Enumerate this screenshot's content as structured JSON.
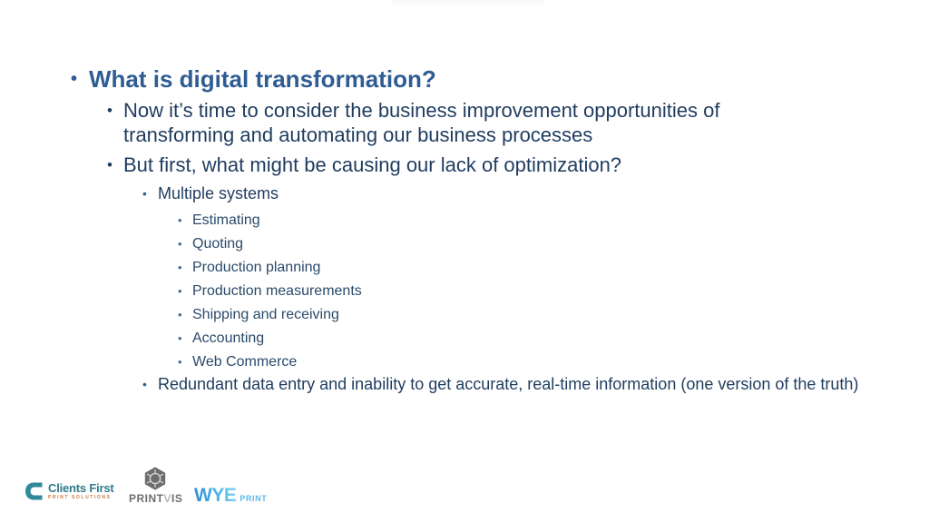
{
  "slide": {
    "title_bullet": "What is digital transformation?",
    "level2": [
      "Now it’s time to consider the business improvement opportunities of transforming and automating our business processes",
      "But first, what might be causing our lack of optimization?"
    ],
    "level3_first": "Multiple systems",
    "level4": [
      "Estimating",
      "Quoting",
      "Production planning",
      "Production measurements",
      "Shipping and receiving",
      "Accounting",
      "Web Commerce"
    ],
    "level3_last": "Redundant data entry and inability to get accurate, real-time information (one version of the truth)",
    "bullet_glyph": "•"
  },
  "footer": {
    "clients_first": {
      "name": "Clients First",
      "tagline": "PRINT SOLUTIONS",
      "mark_icon": "clients-first-c-mark",
      "mark_color": "#2f8a9b",
      "accent_color": "#e2762c",
      "text_color": "#2f7b8c"
    },
    "printvis": {
      "name_part1": "PRINT",
      "name_part2": "V",
      "name_part3": "IS",
      "mark_icon": "printvis-hexagon-mark",
      "mark_color": "#6d6d6d"
    },
    "wye": {
      "name": "WYE",
      "subtitle": "PRINT",
      "color": "#3fa2de"
    }
  },
  "colors": {
    "background": "#ffffff",
    "title": "#2f5c93",
    "body": "#1f3c5f",
    "body_light": "#2a4a6b"
  }
}
